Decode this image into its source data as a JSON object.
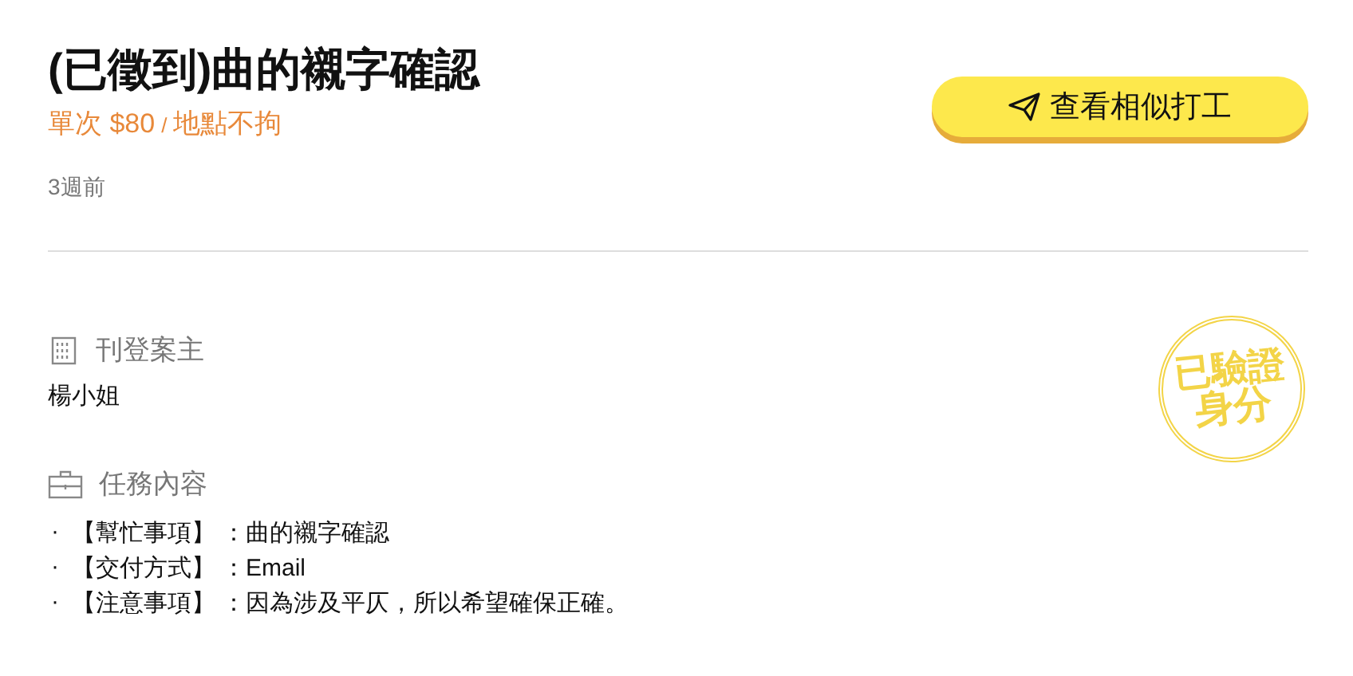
{
  "title": "(已徵到)曲的襯字確認",
  "price": {
    "amount": "單次 $80",
    "separator": "/",
    "location": "地點不拘"
  },
  "posted": "3週前",
  "action_button": {
    "label": "查看相似打工"
  },
  "sections": [
    {
      "kind": "poster",
      "heading": "刊登案主",
      "value": "楊小姐"
    },
    {
      "kind": "task",
      "heading": "任務內容",
      "items": [
        {
          "bullet": "·",
          "label": "【幫忙事項】",
          "value": "：曲的襯字確認"
        },
        {
          "bullet": "·",
          "label": "【交付方式】",
          "value": "：Email"
        },
        {
          "bullet": "·",
          "label": "【注意事項】",
          "value": "：因為涉及平仄，所以希望確保正確。"
        }
      ]
    }
  ],
  "stamp": {
    "line_1": "已驗證",
    "line_2": "身分"
  }
}
